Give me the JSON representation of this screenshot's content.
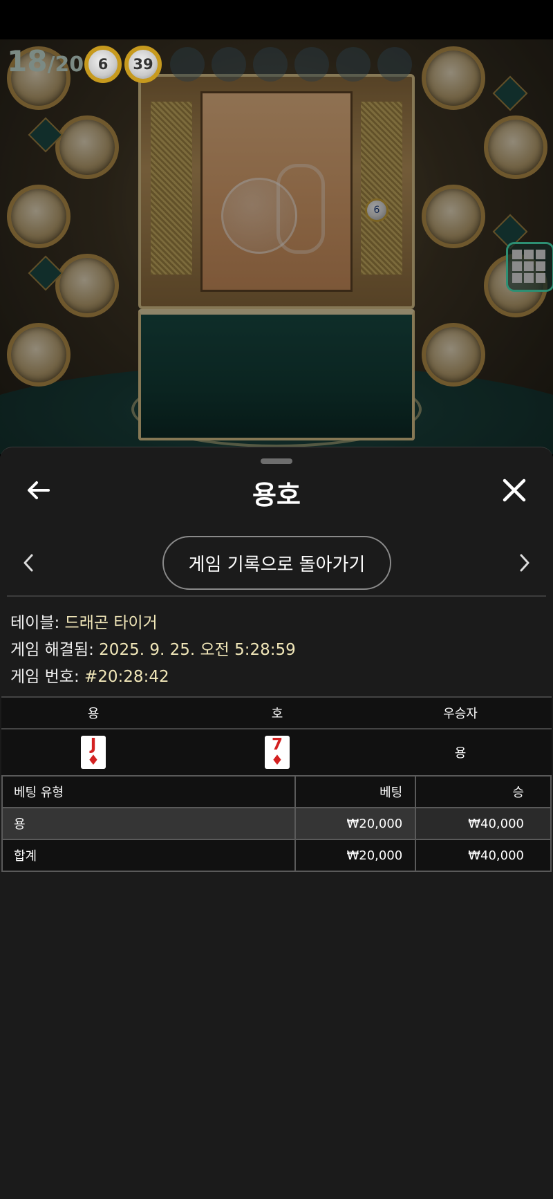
{
  "stage": {
    "draw_current": "18",
    "draw_total": "/20",
    "drawn_balls": [
      "6",
      "39"
    ],
    "machine_ball": "6"
  },
  "sheet": {
    "title": "용호",
    "history_button": "게임 기록으로 돌아가기",
    "info": {
      "table_label": "테이블: ",
      "table_value": "드래곤 타이거",
      "resolved_label": "게임 해결됨: ",
      "resolved_value": "2025. 9. 25. 오전 5:28:59",
      "game_no_label": "게임 번호: ",
      "game_no_value": "#20:28:42"
    },
    "result_table": {
      "headers": [
        "용",
        "호",
        "우승자"
      ],
      "dragon_card": {
        "rank": "J",
        "suit": "♦"
      },
      "tiger_card": {
        "rank": "7",
        "suit": "♦"
      },
      "winner": "용"
    },
    "bet_table": {
      "headers": [
        "베팅 유형",
        "베팅",
        "승"
      ],
      "rows": [
        {
          "type": "용",
          "bet": "₩20,000",
          "win": "₩40,000"
        },
        {
          "type": "합계",
          "bet": "₩20,000",
          "win": "₩40,000"
        }
      ]
    }
  },
  "colors": {
    "sheet_bg": "#1b1b1b",
    "value_text": "#f0e6b8",
    "card_red": "#d32020"
  }
}
